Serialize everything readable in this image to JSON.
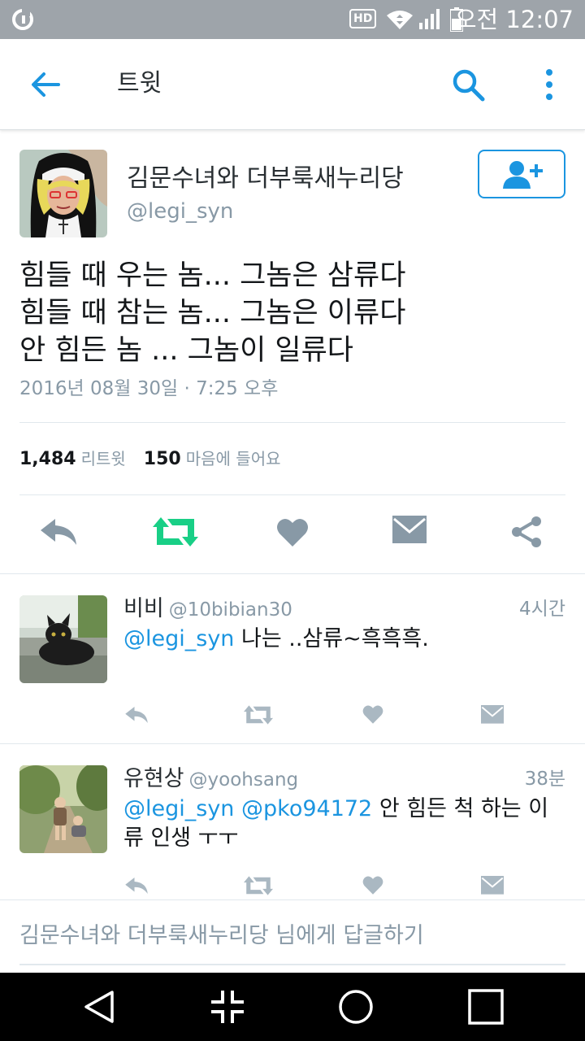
{
  "status_bar": {
    "hd_label": "HD",
    "time": "오전 12:07"
  },
  "app_bar": {
    "title": "트윗",
    "icons": [
      "back-arrow-icon",
      "search-icon",
      "more-vertical-icon"
    ]
  },
  "tweet": {
    "display_name": "김문수녀와 더부룩새누리당",
    "handle": "@legi_syn",
    "lines": [
      "힘들 때 우는 놈... 그놈은 삼류다",
      "힘들 때 참는 놈... 그놈은 이류다",
      "안 힘든 놈 ... 그놈이 일류다"
    ],
    "timestamp": "2016년 08월 30일 · 7:25 오후",
    "retweet_count": "1,484",
    "retweet_label": "리트윗",
    "like_count": "150",
    "like_label": "마음에 들어요",
    "retweeted": true
  },
  "replies": [
    {
      "name": "비비",
      "handle": "@10bibian30",
      "time": "4시간",
      "mention": "@legi_syn",
      "text": " 나는 ..삼류~흑흑흑."
    },
    {
      "name": "유현상",
      "handle": "@yoohsang",
      "time": "38분",
      "mention": "@legi_syn",
      "mention2": "@pko94172",
      "text": " 안 힘든 척 하는 이류 인생 ㅜㅜ"
    }
  ],
  "reply_bar": {
    "placeholder": "김문수녀와 더부룩새누리당 님에게 답글하기"
  },
  "colors": {
    "accent": "#1b95e0",
    "retweet_green": "#19cf86",
    "icon_gray": "#8899a6",
    "status_bar": "#9ea4aa"
  }
}
